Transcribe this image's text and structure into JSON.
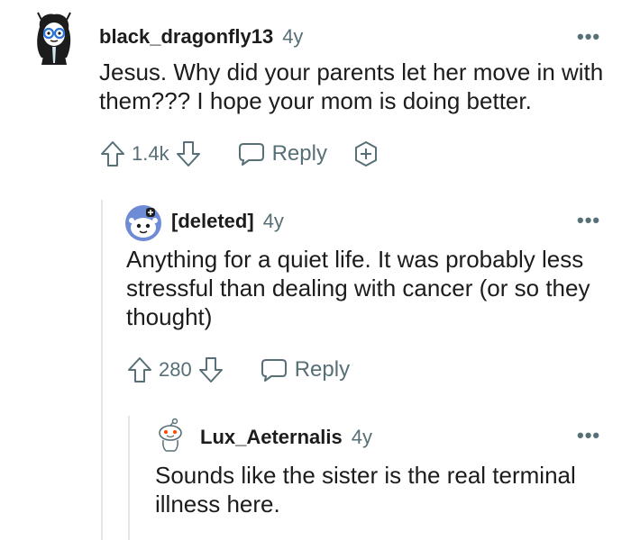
{
  "comments": [
    {
      "username": "black_dragonfly13",
      "age": "4y",
      "text": "Jesus. Why did your parents let her move in with them??? I hope your mom is doing better.",
      "score": "1.4k",
      "reply_label": "Reply",
      "more": "•••",
      "avatar_icon": "girl-glasses-avatar-icon"
    },
    {
      "username": "[deleted]",
      "age": "4y",
      "text": "Anything for a quiet life. It was probably less stressful than dealing with cancer (or so they thought)",
      "score": "280",
      "reply_label": "Reply",
      "more": "•••",
      "avatar_icon": "snoo-avatar-icon"
    },
    {
      "username": "Lux_Aeternalis",
      "age": "4y",
      "text": "Sounds like the sister is the real terminal illness here.",
      "more": "•••",
      "avatar_icon": "snoo-outline-avatar-icon"
    }
  ],
  "colors": {
    "text": "#1c1c1c",
    "meta": "#576f76",
    "thread_line": "#e5e5e5"
  }
}
